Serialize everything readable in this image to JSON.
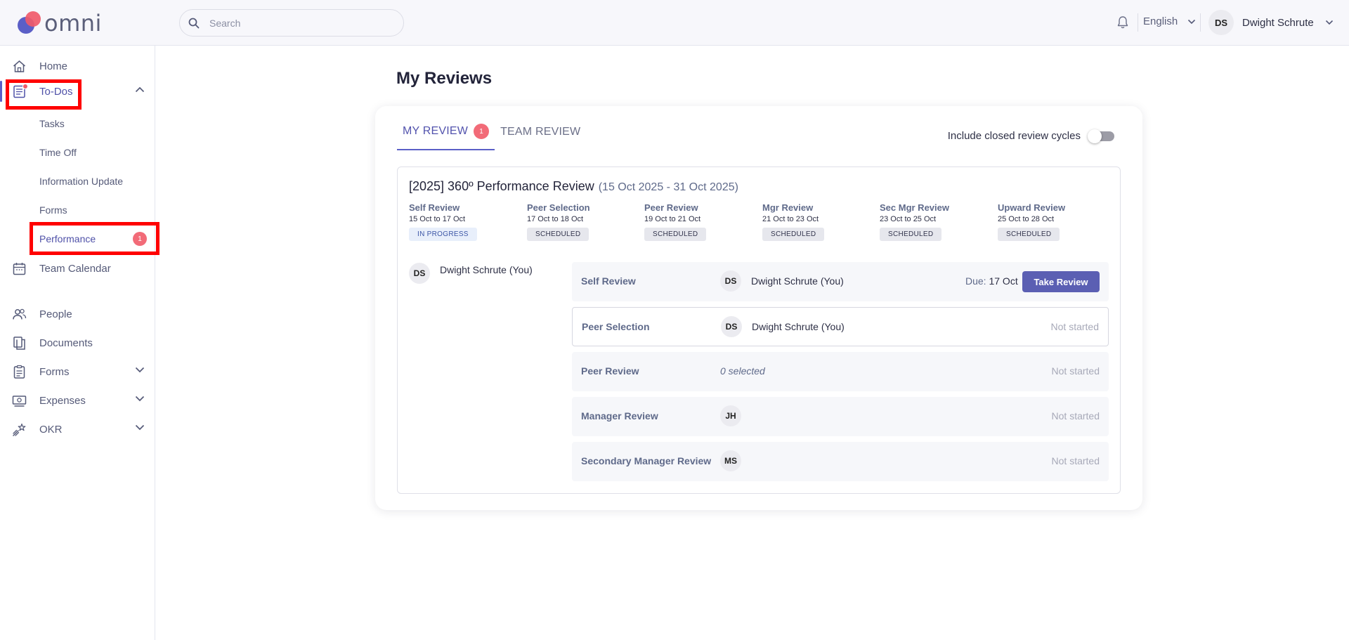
{
  "header": {
    "logo_text": "omni",
    "search_placeholder": "Search",
    "language": "English",
    "user_initials": "DS",
    "user_name": "Dwight Schrute"
  },
  "sidebar": {
    "items": [
      {
        "label": "Home",
        "icon": "home-icon"
      },
      {
        "label": "To-Dos",
        "icon": "todos-icon"
      },
      {
        "label": "Team Calendar",
        "icon": "calendar-icon"
      },
      {
        "label": "People",
        "icon": "people-icon"
      },
      {
        "label": "Documents",
        "icon": "documents-icon"
      },
      {
        "label": "Forms",
        "icon": "forms-icon"
      },
      {
        "label": "Expenses",
        "icon": "expenses-icon"
      },
      {
        "label": "OKR",
        "icon": "okr-icon"
      }
    ],
    "todo_sub": [
      {
        "label": "Tasks"
      },
      {
        "label": "Time Off"
      },
      {
        "label": "Information Update"
      },
      {
        "label": "Forms"
      },
      {
        "label": "Performance",
        "badge": "1"
      }
    ]
  },
  "main": {
    "title": "My Reviews",
    "tabs": [
      {
        "label": "MY REVIEW",
        "badge": "1"
      },
      {
        "label": "TEAM REVIEW"
      }
    ],
    "toggle_label": "Include closed review cycles",
    "cycle": {
      "title": "[2025] 360º Performance Review",
      "range": "(15 Oct 2025 - 31 Oct 2025)",
      "stages": [
        {
          "name": "Self Review",
          "dates": "15 Oct to 17 Oct",
          "status": "IN PROGRESS"
        },
        {
          "name": "Peer Selection",
          "dates": "17 Oct to 18 Oct",
          "status": "SCHEDULED"
        },
        {
          "name": "Peer Review",
          "dates": "19 Oct to 21 Oct",
          "status": "SCHEDULED"
        },
        {
          "name": "Mgr Review",
          "dates": "21 Oct to 23 Oct",
          "status": "SCHEDULED"
        },
        {
          "name": "Sec Mgr Review",
          "dates": "23 Oct to 25 Oct",
          "status": "SCHEDULED"
        },
        {
          "name": "Upward Review",
          "dates": "25 Oct to 28 Oct",
          "status": "SCHEDULED"
        }
      ],
      "reviewee": {
        "initials": "DS",
        "name": "Dwight Schrute (You)"
      },
      "rows": [
        {
          "label": "Self Review",
          "initials": "DS",
          "person": "Dwight Schrute (You)",
          "due_label": "Due:",
          "due_date": "17 Oct",
          "action": "Take Review"
        },
        {
          "label": "Peer Selection",
          "initials": "DS",
          "person": "Dwight Schrute (You)",
          "status": "Not started"
        },
        {
          "label": "Peer Review",
          "selected": "0 selected",
          "status": "Not started"
        },
        {
          "label": "Manager Review",
          "initials": "JH",
          "status": "Not started"
        },
        {
          "label": "Secondary Manager Review",
          "initials": "MS",
          "status": "Not started"
        }
      ]
    }
  },
  "colors": {
    "accent": "#5b5fc7",
    "badge": "#f26b78",
    "highlight": "#ff0000"
  }
}
